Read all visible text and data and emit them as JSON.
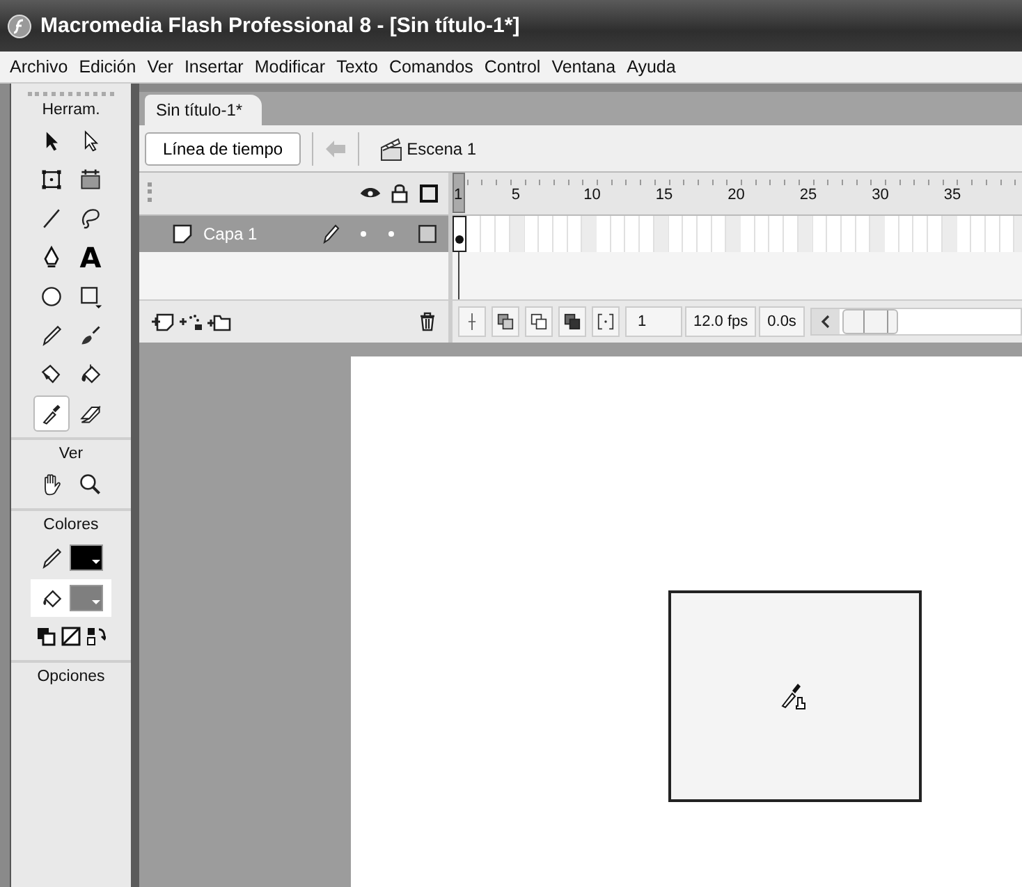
{
  "window": {
    "title": "Macromedia Flash Professional 8 - [Sin título-1*]"
  },
  "menu": [
    "Archivo",
    "Edición",
    "Ver",
    "Insertar",
    "Modificar",
    "Texto",
    "Comandos",
    "Control",
    "Ventana",
    "Ayuda"
  ],
  "toolbox": {
    "title": "Herram.",
    "tools": [
      {
        "kind": "arrow",
        "selected": false
      },
      {
        "kind": "subselect",
        "selected": false
      },
      {
        "kind": "transform",
        "selected": false
      },
      {
        "kind": "gradient",
        "selected": false
      },
      {
        "kind": "line",
        "selected": false
      },
      {
        "kind": "lasso",
        "selected": false
      },
      {
        "kind": "pen",
        "selected": false
      },
      {
        "kind": "text",
        "label": "A",
        "selected": false
      },
      {
        "kind": "oval",
        "selected": false
      },
      {
        "kind": "rect",
        "selected": false
      },
      {
        "kind": "pencil",
        "selected": false
      },
      {
        "kind": "brush",
        "selected": false
      },
      {
        "kind": "ink",
        "selected": false
      },
      {
        "kind": "bucket",
        "selected": false
      },
      {
        "kind": "eyedropper",
        "selected": true
      },
      {
        "kind": "eraser",
        "selected": false
      }
    ],
    "view_title": "Ver",
    "view_tools": [
      {
        "kind": "hand",
        "selected": false
      },
      {
        "kind": "zoom",
        "selected": false
      }
    ],
    "colors_title": "Colores",
    "swatches": [
      {
        "kind": "stroke",
        "color": "#000000",
        "selected": false
      },
      {
        "kind": "fill",
        "color": "#7f7f7f",
        "selected": true
      }
    ],
    "options_title": "Opciones"
  },
  "document_tabs": [
    {
      "label": "Sin título-1*",
      "selected": true
    }
  ],
  "edit_bar": {
    "timeline_button": "Línea de tiempo",
    "scene": "Escena 1"
  },
  "timeline": {
    "ruler": [
      "1",
      "5",
      "10",
      "15",
      "20",
      "25",
      "30",
      "35"
    ],
    "layers": [
      {
        "name": "Capa 1",
        "selected": true
      }
    ],
    "current_frame": "1",
    "frame_rate": "12.0 fps",
    "elapsed_time": "0.0s"
  }
}
